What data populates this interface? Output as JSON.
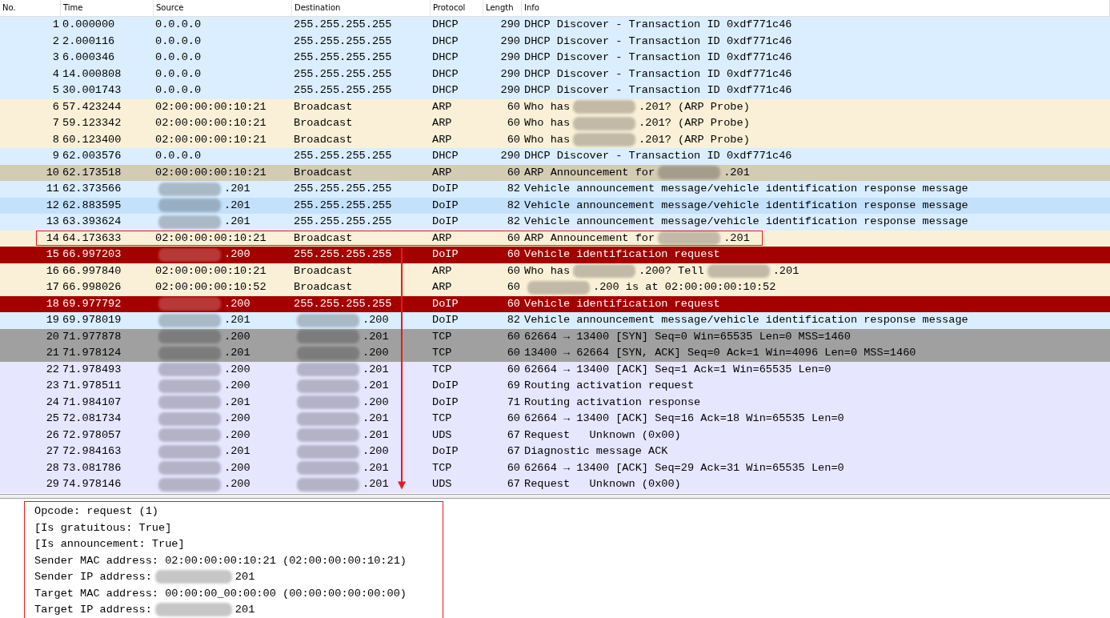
{
  "columns": [
    "No.",
    "Time",
    "Source",
    "Destination",
    "Protocol",
    "Length",
    "Info"
  ],
  "rows": [
    {
      "no": "1",
      "time": "0.000000",
      "source": "0.0.0.0",
      "source_blurred": false,
      "destination": "255.255.255.255",
      "destination_blurred": false,
      "protocol": "DHCP",
      "length": "290",
      "info": [
        "DHCP Discover - Transaction ID 0xdf771c46"
      ],
      "info_lead_blur": false,
      "color": "#daeeff",
      "boxed": false
    },
    {
      "no": "2",
      "time": "2.000116",
      "source": "0.0.0.0",
      "source_blurred": false,
      "destination": "255.255.255.255",
      "destination_blurred": false,
      "protocol": "DHCP",
      "length": "290",
      "info": [
        "DHCP Discover - Transaction ID 0xdf771c46"
      ],
      "info_lead_blur": false,
      "color": "#daeeff",
      "boxed": false
    },
    {
      "no": "3",
      "time": "6.000346",
      "source": "0.0.0.0",
      "source_blurred": false,
      "destination": "255.255.255.255",
      "destination_blurred": false,
      "protocol": "DHCP",
      "length": "290",
      "info": [
        "DHCP Discover - Transaction ID 0xdf771c46"
      ],
      "info_lead_blur": false,
      "color": "#daeeff",
      "boxed": false
    },
    {
      "no": "4",
      "time": "14.000808",
      "source": "0.0.0.0",
      "source_blurred": false,
      "destination": "255.255.255.255",
      "destination_blurred": false,
      "protocol": "DHCP",
      "length": "290",
      "info": [
        "DHCP Discover - Transaction ID 0xdf771c46"
      ],
      "info_lead_blur": false,
      "color": "#daeeff",
      "boxed": false
    },
    {
      "no": "5",
      "time": "30.001743",
      "source": "0.0.0.0",
      "source_blurred": false,
      "destination": "255.255.255.255",
      "destination_blurred": false,
      "protocol": "DHCP",
      "length": "290",
      "info": [
        "DHCP Discover - Transaction ID 0xdf771c46"
      ],
      "info_lead_blur": false,
      "color": "#daeeff",
      "boxed": false
    },
    {
      "no": "6",
      "time": "57.423244",
      "source": "02:00:00:00:10:21",
      "source_blurred": false,
      "destination": "Broadcast",
      "destination_blurred": false,
      "protocol": "ARP",
      "length": "60",
      "info": [
        "Who has",
        ".201? (ARP Probe)"
      ],
      "info_lead_blur": false,
      "color": "#faf0d7",
      "boxed": false
    },
    {
      "no": "7",
      "time": "59.123342",
      "source": "02:00:00:00:10:21",
      "source_blurred": false,
      "destination": "Broadcast",
      "destination_blurred": false,
      "protocol": "ARP",
      "length": "60",
      "info": [
        "Who has",
        ".201? (ARP Probe)"
      ],
      "info_lead_blur": false,
      "color": "#faf0d7",
      "boxed": false
    },
    {
      "no": "8",
      "time": "60.123400",
      "source": "02:00:00:00:10:21",
      "source_blurred": false,
      "destination": "Broadcast",
      "destination_blurred": false,
      "protocol": "ARP",
      "length": "60",
      "info": [
        "Who has",
        ".201? (ARP Probe)"
      ],
      "info_lead_blur": false,
      "color": "#faf0d7",
      "boxed": false
    },
    {
      "no": "9",
      "time": "62.003576",
      "source": "0.0.0.0",
      "source_blurred": false,
      "destination": "255.255.255.255",
      "destination_blurred": false,
      "protocol": "DHCP",
      "length": "290",
      "info": [
        "DHCP Discover - Transaction ID 0xdf771c46"
      ],
      "info_lead_blur": false,
      "color": "#daeeff",
      "boxed": false
    },
    {
      "no": "10",
      "time": "62.173518",
      "source": "02:00:00:00:10:21",
      "source_blurred": false,
      "destination": "Broadcast",
      "destination_blurred": false,
      "protocol": "ARP",
      "length": "60",
      "info": [
        "ARP Announcement for",
        ".201"
      ],
      "info_lead_blur": false,
      "color": "#d4cbb5",
      "boxed": false
    },
    {
      "no": "11",
      "time": "62.373566",
      "source": ".201",
      "source_blurred": true,
      "destination": "255.255.255.255",
      "destination_blurred": false,
      "protocol": "DoIP",
      "length": "82",
      "info": [
        "Vehicle announcement message/vehicle identification response message"
      ],
      "info_lead_blur": false,
      "color": "#daeeff",
      "boxed": false
    },
    {
      "no": "12",
      "time": "62.883595",
      "source": ".201",
      "source_blurred": true,
      "destination": "255.255.255.255",
      "destination_blurred": false,
      "protocol": "DoIP",
      "length": "82",
      "info": [
        "Vehicle announcement message/vehicle identification response message"
      ],
      "info_lead_blur": false,
      "color": "#c4e1fb",
      "boxed": false
    },
    {
      "no": "13",
      "time": "63.393624",
      "source": ".201",
      "source_blurred": true,
      "destination": "255.255.255.255",
      "destination_blurred": false,
      "protocol": "DoIP",
      "length": "82",
      "info": [
        "Vehicle announcement message/vehicle identification response message"
      ],
      "info_lead_blur": false,
      "color": "#daeeff",
      "boxed": false
    },
    {
      "no": "14",
      "time": "64.173633",
      "source": "02:00:00:00:10:21",
      "source_blurred": false,
      "destination": "Broadcast",
      "destination_blurred": false,
      "protocol": "ARP",
      "length": "60",
      "info": [
        "ARP Announcement for",
        ".201"
      ],
      "info_lead_blur": false,
      "color": "#faf0d7",
      "boxed": true
    },
    {
      "no": "15",
      "time": "66.997203",
      "source": ".200",
      "source_blurred": true,
      "destination": "255.255.255.255",
      "destination_blurred": false,
      "protocol": "DoIP",
      "length": "60",
      "info": [
        "Vehicle identification request"
      ],
      "info_lead_blur": false,
      "color": "#a40000",
      "boxed": false
    },
    {
      "no": "16",
      "time": "66.997840",
      "source": "02:00:00:00:10:21",
      "source_blurred": false,
      "destination": "Broadcast",
      "destination_blurred": false,
      "protocol": "ARP",
      "length": "60",
      "info": [
        "Who has",
        ".200? Tell",
        ".201"
      ],
      "info_lead_blur": false,
      "color": "#faf0d7",
      "boxed": false
    },
    {
      "no": "17",
      "time": "66.998026",
      "source": "02:00:00:00:10:52",
      "source_blurred": false,
      "destination": "Broadcast",
      "destination_blurred": false,
      "protocol": "ARP",
      "length": "60",
      "info": [
        ".200 is at 02:00:00:00:10:52"
      ],
      "info_lead_blur": true,
      "color": "#faf0d7",
      "boxed": false
    },
    {
      "no": "18",
      "time": "69.977792",
      "source": ".200",
      "source_blurred": true,
      "destination": "255.255.255.255",
      "destination_blurred": false,
      "protocol": "DoIP",
      "length": "60",
      "info": [
        "Vehicle identification request"
      ],
      "info_lead_blur": false,
      "color": "#a40000",
      "boxed": false
    },
    {
      "no": "19",
      "time": "69.978019",
      "source": ".201",
      "source_blurred": true,
      "destination": ".200",
      "destination_blurred": true,
      "protocol": "DoIP",
      "length": "82",
      "info": [
        "Vehicle announcement message/vehicle identification response message"
      ],
      "info_lead_blur": false,
      "color": "#daeeff",
      "boxed": false
    },
    {
      "no": "20",
      "time": "71.977878",
      "source": ".200",
      "source_blurred": true,
      "destination": ".201",
      "destination_blurred": true,
      "protocol": "TCP",
      "length": "60",
      "info": [
        "62664 → 13400 [SYN] Seq=0 Win=65535 Len=0 MSS=1460"
      ],
      "info_lead_blur": false,
      "color": "#a0a0a0",
      "boxed": false
    },
    {
      "no": "21",
      "time": "71.978124",
      "source": ".201",
      "source_blurred": true,
      "destination": ".200",
      "destination_blurred": true,
      "protocol": "TCP",
      "length": "60",
      "info": [
        "13400 → 62664 [SYN, ACK] Seq=0 Ack=1 Win=4096 Len=0 MSS=1460"
      ],
      "info_lead_blur": false,
      "color": "#a0a0a0",
      "boxed": false
    },
    {
      "no": "22",
      "time": "71.978493",
      "source": ".200",
      "source_blurred": true,
      "destination": ".201",
      "destination_blurred": true,
      "protocol": "TCP",
      "length": "60",
      "info": [
        "62664 → 13400 [ACK] Seq=1 Ack=1 Win=65535 Len=0"
      ],
      "info_lead_blur": false,
      "color": "#e7e6ff",
      "boxed": false
    },
    {
      "no": "23",
      "time": "71.978511",
      "source": ".200",
      "source_blurred": true,
      "destination": ".201",
      "destination_blurred": true,
      "protocol": "DoIP",
      "length": "69",
      "info": [
        "Routing activation request"
      ],
      "info_lead_blur": false,
      "color": "#e7e6ff",
      "boxed": false
    },
    {
      "no": "24",
      "time": "71.984107",
      "source": ".201",
      "source_blurred": true,
      "destination": ".200",
      "destination_blurred": true,
      "protocol": "DoIP",
      "length": "71",
      "info": [
        "Routing activation response"
      ],
      "info_lead_blur": false,
      "color": "#e7e6ff",
      "boxed": false
    },
    {
      "no": "25",
      "time": "72.081734",
      "source": ".200",
      "source_blurred": true,
      "destination": ".201",
      "destination_blurred": true,
      "protocol": "TCP",
      "length": "60",
      "info": [
        "62664 → 13400 [ACK] Seq=16 Ack=18 Win=65535 Len=0"
      ],
      "info_lead_blur": false,
      "color": "#e7e6ff",
      "boxed": false
    },
    {
      "no": "26",
      "time": "72.978057",
      "source": ".200",
      "source_blurred": true,
      "destination": ".201",
      "destination_blurred": true,
      "protocol": "UDS",
      "length": "67",
      "info": [
        "Request   Unknown (0x00)"
      ],
      "info_lead_blur": false,
      "color": "#e7e6ff",
      "boxed": false
    },
    {
      "no": "27",
      "time": "72.984163",
      "source": ".201",
      "source_blurred": true,
      "destination": ".200",
      "destination_blurred": true,
      "protocol": "DoIP",
      "length": "67",
      "info": [
        "Diagnostic message ACK"
      ],
      "info_lead_blur": false,
      "color": "#e7e6ff",
      "boxed": false
    },
    {
      "no": "28",
      "time": "73.081786",
      "source": ".200",
      "source_blurred": true,
      "destination": ".201",
      "destination_blurred": true,
      "protocol": "TCP",
      "length": "60",
      "info": [
        "62664 → 13400 [ACK] Seq=29 Ack=31 Win=65535 Len=0"
      ],
      "info_lead_blur": false,
      "color": "#e7e6ff",
      "boxed": false
    },
    {
      "no": "29",
      "time": "74.978146",
      "source": ".200",
      "source_blurred": true,
      "destination": ".201",
      "destination_blurred": true,
      "protocol": "UDS",
      "length": "67",
      "info": [
        "Request   Unknown (0x00)"
      ],
      "info_lead_blur": false,
      "color": "#e7e6ff",
      "boxed": false
    }
  ],
  "details": {
    "boxed": true,
    "lines": [
      {
        "parts": [
          "Opcode: request (1)"
        ]
      },
      {
        "parts": [
          "[Is gratuitous: True]"
        ]
      },
      {
        "parts": [
          "[Is announcement: True]"
        ]
      },
      {
        "parts": [
          "Sender MAC address: 02:00:00:00:10:21 (02:00:00:00:10:21)"
        ]
      },
      {
        "parts": [
          "Sender IP address:",
          "201"
        ]
      },
      {
        "parts": [
          "Target MAC address: 00:00:00_00:00:00 (00:00:00:00:00:00)"
        ]
      },
      {
        "parts": [
          "Target IP address:",
          "201"
        ]
      }
    ]
  }
}
